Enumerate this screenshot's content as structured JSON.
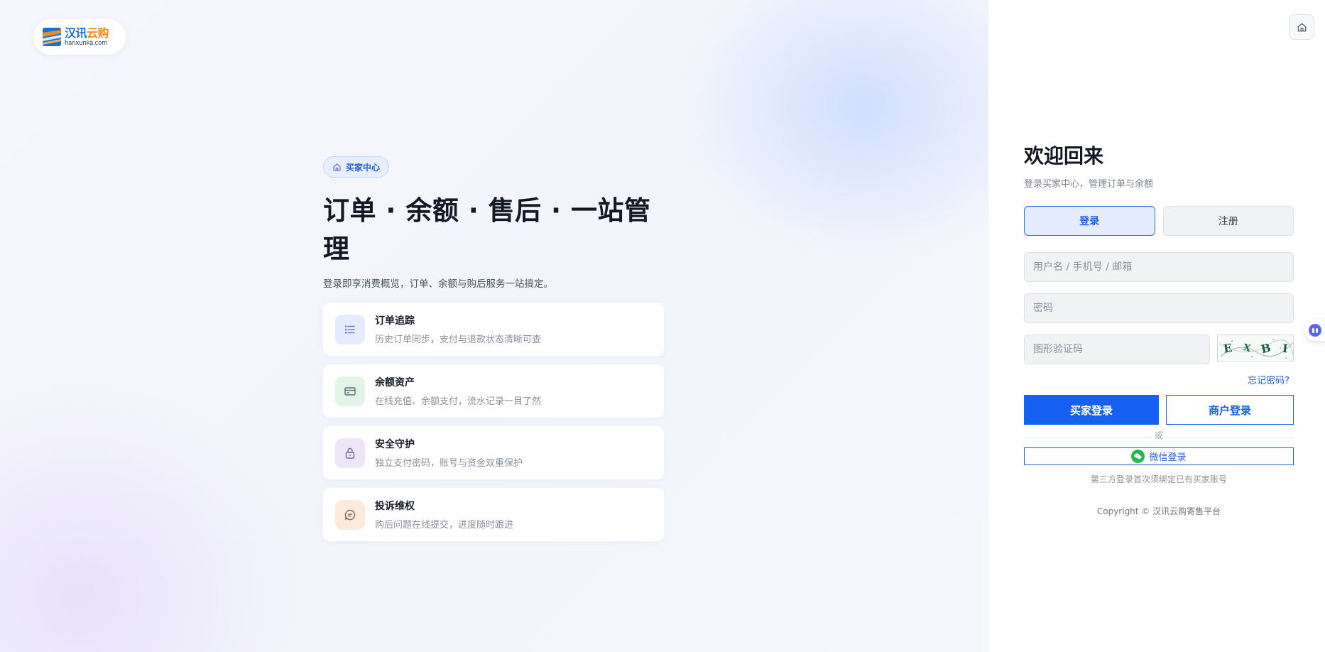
{
  "brand": {
    "name_part1": "汉讯",
    "name_part2": "云购",
    "domain": "hanxunka.com",
    "primary_color": "#1761f2"
  },
  "hero": {
    "chip_label": "买家中心",
    "chip_icon": "home-icon",
    "title": "订单 · 余额 · 售后 · 一站管理",
    "subtitle": "登录即享消费概览，订单、余额与购后服务一站搞定。",
    "features": [
      {
        "icon": "list-icon",
        "title": "订单追踪",
        "desc": "历史订单同步，支付与退款状态清晰可查"
      },
      {
        "icon": "card-icon",
        "title": "余额资产",
        "desc": "在线充值、余额支付，流水记录一目了然"
      },
      {
        "icon": "lock-icon",
        "title": "安全守护",
        "desc": "独立支付密码，账号与资金双重保护"
      },
      {
        "icon": "chat-icon",
        "title": "投诉维权",
        "desc": "购后问题在线提交，进度随时跟进"
      }
    ]
  },
  "form": {
    "welcome": "欢迎回来",
    "welcome_sub": "登录买家中心，管理订单与余额",
    "tabs": [
      {
        "label": "登录",
        "active": true
      },
      {
        "label": "注册",
        "active": false
      }
    ],
    "username": {
      "placeholder": "用户名 / 手机号 / 邮箱",
      "value": ""
    },
    "password": {
      "placeholder": "密码",
      "value": ""
    },
    "captcha": {
      "placeholder": "图形验证码",
      "value": "",
      "image_chars": [
        "E",
        "X",
        "B",
        "I"
      ]
    },
    "forgot_label": "忘记密码?",
    "buyer_login_label": "买家登录",
    "merchant_login_label": "商户登录",
    "divider_label": "或",
    "wechat_login_label": "微信登录",
    "third_party_note": "第三方登录首次须绑定已有买家账号",
    "copyright": "Copyright © 汉讯云购寄售平台"
  }
}
